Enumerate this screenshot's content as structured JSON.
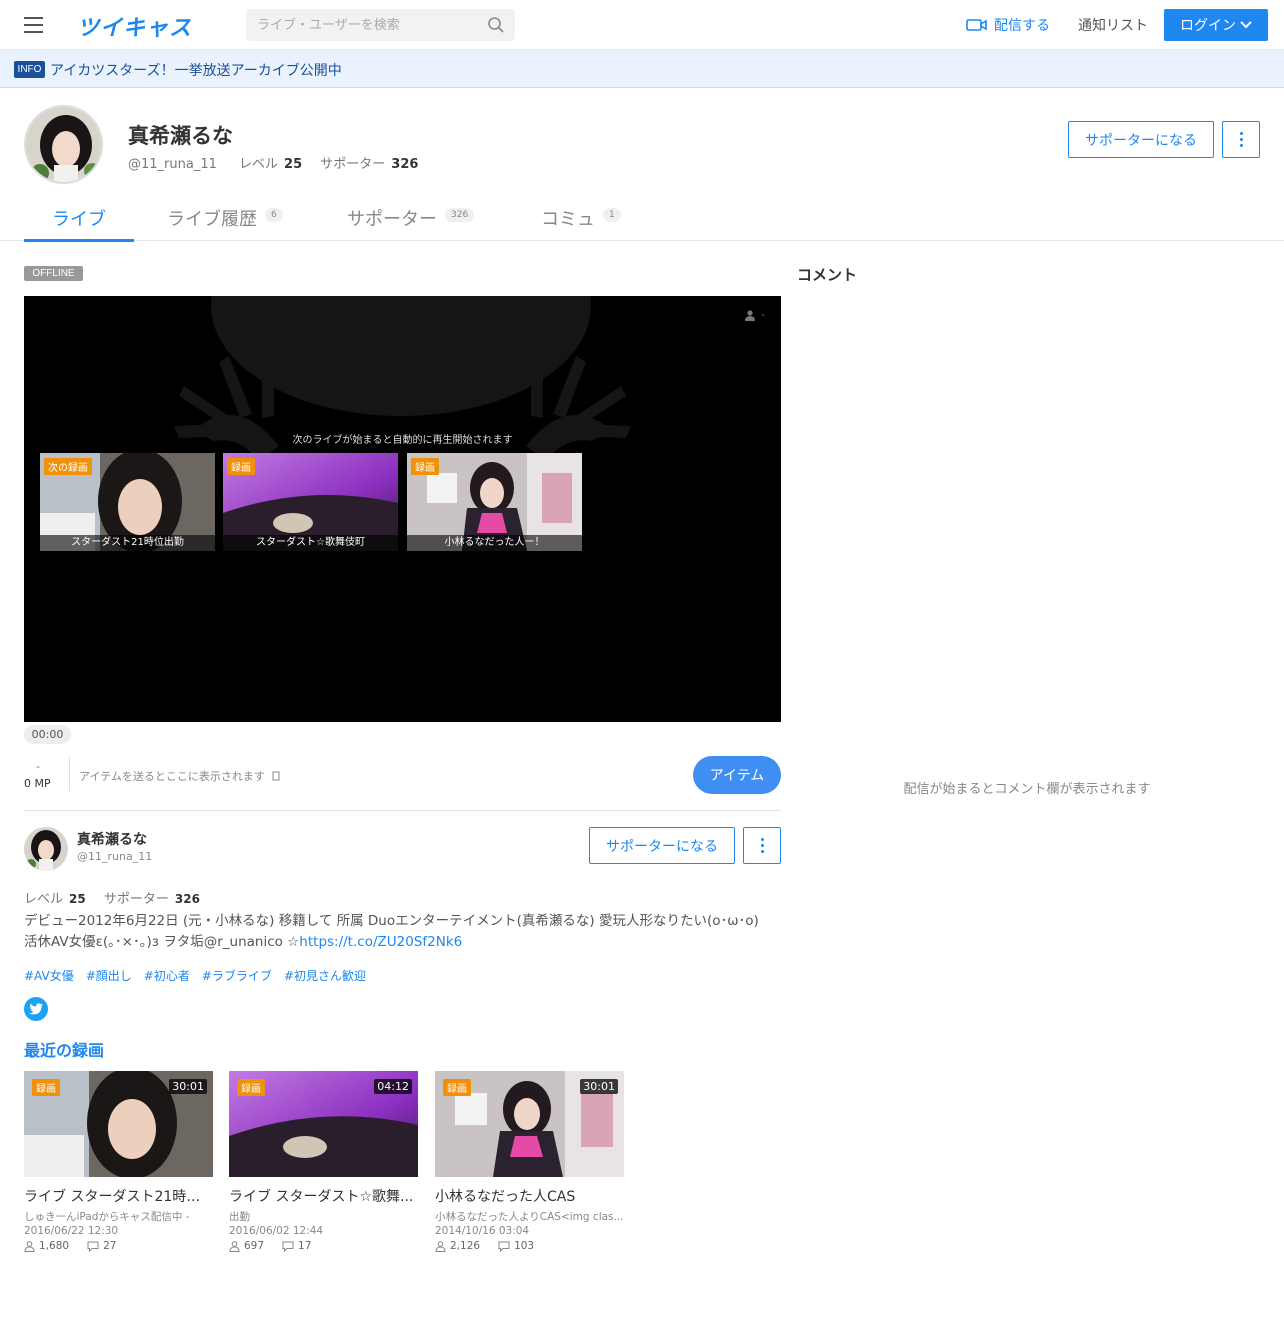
{
  "header": {
    "logo": "ツイキャス",
    "search_placeholder": "ライブ・ユーザーを検索",
    "broadcast_label": "配信する",
    "notify_label": "通知リスト",
    "login_label": "ログイン"
  },
  "info": {
    "badge": "INFO",
    "text": "アイカツスターズ！一挙放送アーカイブ公開中"
  },
  "profile": {
    "name": "真希瀬るな",
    "handle": "@11_runa_11",
    "level_label": "レベル",
    "level": "25",
    "supporter_label": "サポーター",
    "supporters": "326",
    "support_button": "サポーターになる"
  },
  "tabs": [
    {
      "label": "ライブ",
      "count": ""
    },
    {
      "label": "ライブ履歴",
      "count": "6"
    },
    {
      "label": "サポーター",
      "count": "326"
    },
    {
      "label": "コミュ",
      "count": "1"
    }
  ],
  "player": {
    "status": "OFFLINE",
    "viewer_count": "-",
    "next_text": "次のライブが始まると自動的に再生開始されます",
    "thumbs": [
      {
        "badge": "次の録画",
        "caption": "スターダスト21時位出勤"
      },
      {
        "badge": "録画",
        "caption": "スターダスト☆歌舞伎町"
      },
      {
        "badge": "録画",
        "caption": "小林るなだった人ー！"
      }
    ],
    "time": "00:00",
    "mp_dash": "-",
    "mp": "0 MP",
    "item_text": "アイテムを送るとここに表示されます",
    "item_button": "アイテム"
  },
  "comments": {
    "title": "コメント",
    "empty": "配信が始まるとコメント欄が表示されます"
  },
  "bio": {
    "text": "デビュー2012年6月22日 (元・小林るな) 移籍して 所属 Duoエンターテイメント(真希瀬るな) 愛玩人形なりたい(o･ω･o)　活休AV女優ε(｡･×･｡)з ヲタ垢@r_unanico ☆",
    "link": "https://t.co/ZU20Sf2Nk6",
    "tags": [
      "#AV女優",
      "#顔出し",
      "#初心者",
      "#ラブライブ",
      "#初見さん歓迎"
    ]
  },
  "recent": {
    "title": "最近の録画",
    "items": [
      {
        "badge": "録画",
        "duration": "30:01",
        "title": "ライブ スターダスト21時位...",
        "subtitle": "しゅきーんiPadからキャス配信中 -",
        "date": "2016/06/22 12:30",
        "views": "1,680",
        "comments": "27"
      },
      {
        "badge": "録画",
        "duration": "04:12",
        "title": "ライブ スターダスト☆歌舞...",
        "subtitle": "出勤",
        "date": "2016/06/02 12:44",
        "views": "697",
        "comments": "17"
      },
      {
        "badge": "録画",
        "duration": "30:01",
        "title": "小林るなだった人CAS",
        "subtitle": "小林るなだった人よりCAS<img clas...",
        "date": "2014/10/16 03:04",
        "views": "2,126",
        "comments": "103"
      }
    ]
  },
  "colors": {
    "accent": "#1e87f0",
    "record_badge": "#f0910c",
    "info_bg": "#eaf3fd"
  }
}
